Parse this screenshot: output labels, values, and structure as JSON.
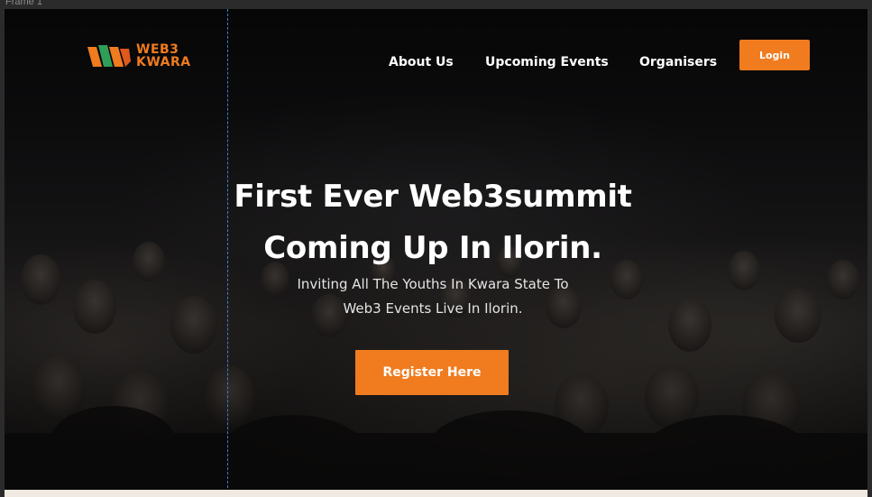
{
  "canvas": {
    "frame_label": "Frame 1"
  },
  "brand": {
    "line1": "WEB3",
    "line2": "KWARA",
    "accent": "#f07c1f"
  },
  "nav": {
    "items": [
      "About Us",
      "Upcoming Events",
      "Organisers"
    ],
    "login_label": "Login"
  },
  "hero": {
    "title_line1": "First Ever Web3summit",
    "title_line2": "Coming Up In Ilorin.",
    "subtitle_line1": "Inviting All The Youths In Kwara State To",
    "subtitle_line2": "Web3 Events Live In Ilorin.",
    "cta_label": "Register Here"
  },
  "colors": {
    "accent": "#f07c1f",
    "text": "#ffffff",
    "guide": "#3d7fd6"
  }
}
